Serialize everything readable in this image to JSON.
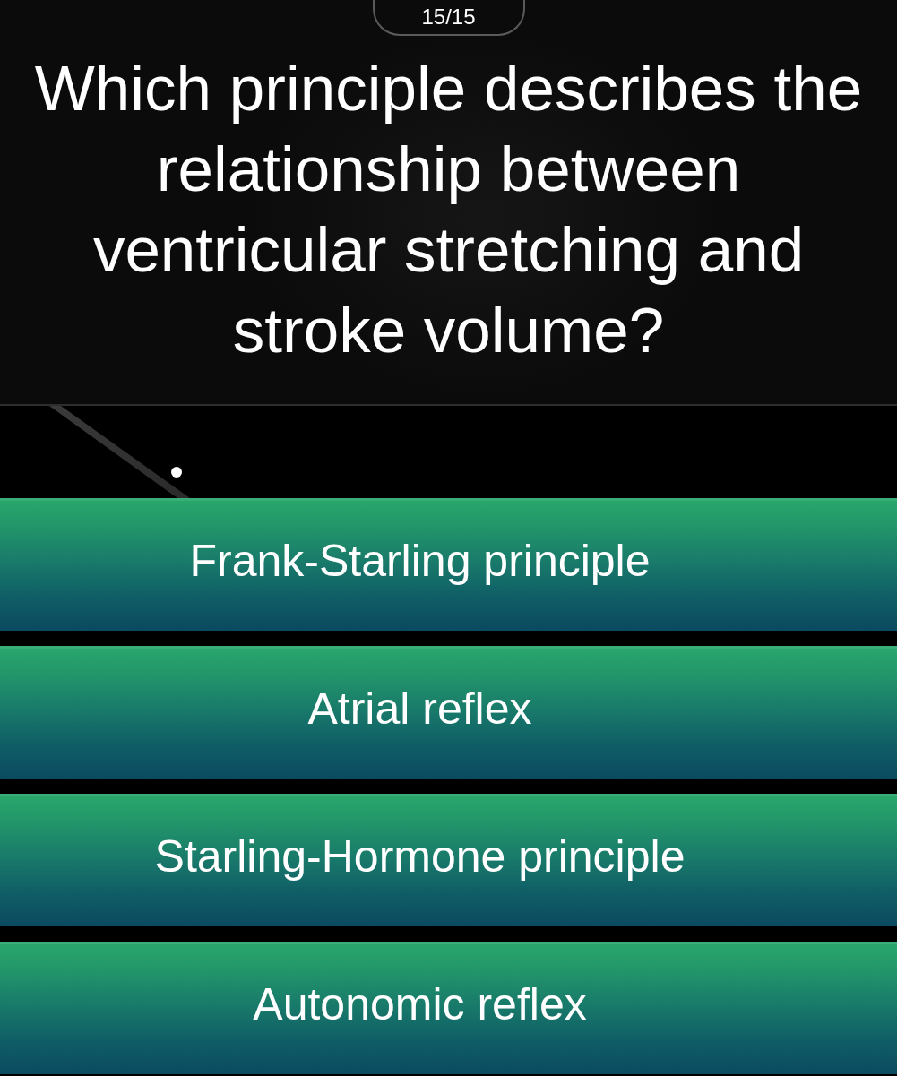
{
  "counter": "15/15",
  "question": "Which principle describes the relationship between ventricular stretching and stroke volume?",
  "answers": [
    "Frank-Starling principle",
    "Atrial reflex",
    "Starling-Hormone principle",
    "Autonomic reflex"
  ]
}
